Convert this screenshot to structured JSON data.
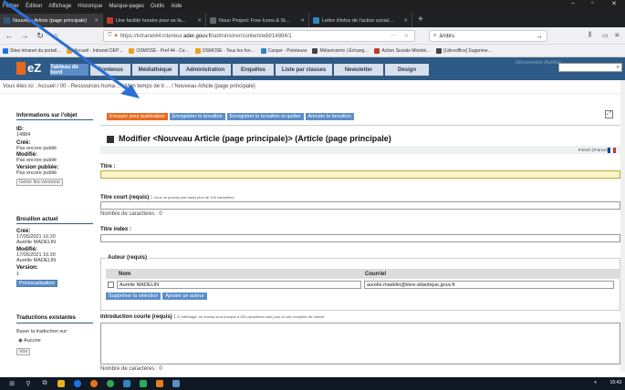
{
  "browser": {
    "menu": [
      "Fichier",
      "Édition",
      "Affichage",
      "Historique",
      "Marque-pages",
      "Outils",
      "Aide"
    ],
    "window_controls": [
      "–",
      "▫",
      "✕"
    ],
    "tabs": [
      {
        "title": "Nouveau Article (page principale)",
        "active": true,
        "color": "#2e5a87"
      },
      {
        "title": "Une facilité horaire pour se fa…",
        "active": false,
        "color": "#c0392b"
      },
      {
        "title": "Noun Project: Free Icons & St…",
        "active": false,
        "color": "#444"
      },
      {
        "title": "Lettre d'infos de l'action social…",
        "active": false,
        "color": "#2e86c1"
      }
    ],
    "new_tab": "+",
    "url_prefix": "https://intranet44.interieur.",
    "url_domain": "ader.gouv.fr",
    "url_suffix": "/administrer/content/edit/14884/1",
    "search_value": "ämbru",
    "bookmarks": [
      {
        "label": "Sites intranet du portail…",
        "color": "#1a73e8"
      },
      {
        "label": "Accueil - Intranet DEP…",
        "color": "#e8a21f"
      },
      {
        "label": "OSMOSE - Pref 44 - Ce…",
        "color": "#e8a21f"
      },
      {
        "label": "OSMOSE - Tous les fon…",
        "color": "#e8a21f"
      },
      {
        "label": "Casper - Pointeuse",
        "color": "#2e86c1"
      },
      {
        "label": "Mélanissimo | Échang…",
        "color": "#444"
      },
      {
        "label": "Action Sociale Ministé…",
        "color": "#c0392b"
      },
      {
        "label": "[Libreoffice] Supprime…",
        "color": "#444"
      }
    ]
  },
  "app": {
    "logo": "eZ",
    "tabs": [
      "Tableau de bord",
      "Contenus",
      "Médiathèque",
      "Administration",
      "Enquêtes",
      "Liste par classes",
      "Newsletter",
      "Design"
    ],
    "logout": "Déconnexion (Aurélie)"
  },
  "breadcrumb": "Vous êtes ici : Accueil / 00 - Ressources huma… / Mon temps de tr… / Nouveau Article (page principale)",
  "sidebar": {
    "info_title": "Informations sur l'objet",
    "id_label": "ID:",
    "id_value": "14884",
    "created_label": "Créé:",
    "created_value": "Pas encore publié",
    "modified_label": "Modifié:",
    "modified_value": "Pas encore publié",
    "published_label": "Version publiée:",
    "published_value": "Pas encore publié",
    "manage_versions": "Gérer les versions",
    "draft_title": "Brouillon actuel",
    "draft_created_label": "Créé:",
    "draft_created_date": "17/05/2021 16:20",
    "draft_created_by": "Aurélie MADELIN",
    "draft_modified_label": "Modifié:",
    "draft_modified_date": "17/05/2021 16:20",
    "draft_modified_by": "Aurélie MADELIN",
    "version_label": "Version:",
    "version_value": "1",
    "preview": "Prévisualisation",
    "translations_title": "Traductions existantes",
    "base_translation": "Baser la traduction sur:",
    "none_option": "Aucune",
    "view_button": "Voir"
  },
  "toolbar": {
    "publish": "Envoyer pour publication",
    "save_draft": "Enregistrer le brouillon",
    "save_quit": "Enregistrer le brouillon et quitter",
    "cancel": "Annuler le brouillon"
  },
  "form": {
    "heading": "Modifier <Nouveau Article (page principale)> (Article (page principale)",
    "language": "French (France)",
    "title_label": "Titre :",
    "short_title_label": "Titre court (requis) :",
    "short_title_hint": "Vous ne pouvez pas saisir plus de 100 caractères",
    "char_count": "Nombre de caractères : 0",
    "index_title_label": "Titre index :",
    "author_legend": "Auteur (requis)",
    "col_name": "Nom",
    "col_email": "Courriel",
    "author_name": "Aurélie MADELIN",
    "author_email": "aurelie.madelin@loire-atlantique.gouv.fr",
    "remove_selection": "Supprimer la sélection",
    "add_author": "Ajouter un auteur",
    "intro_label": "Introduction courte (requis) :",
    "intro_hint": "À l'affichage, ce champ sera tronqué à 250 caractères sauf pour la vue complète de l'article",
    "intro_char_count": "Nombre de caractères : 0"
  },
  "taskbar": {
    "time": "16:43"
  }
}
